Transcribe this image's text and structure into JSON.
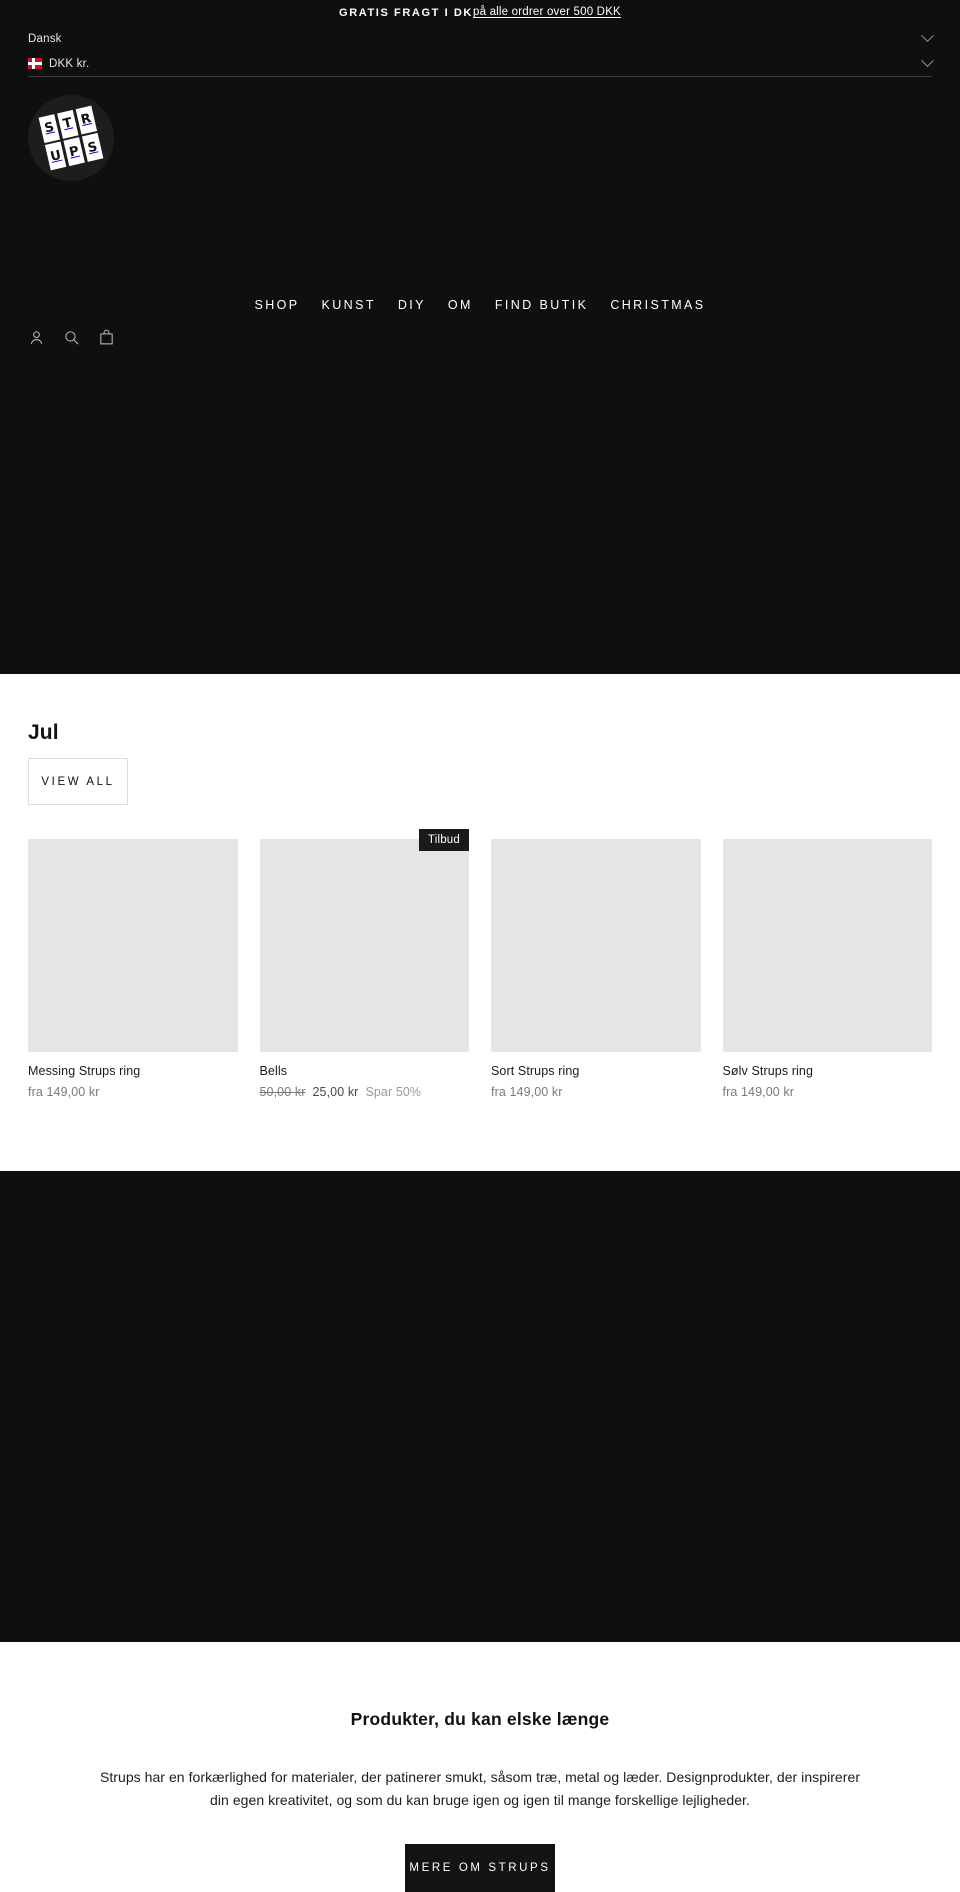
{
  "announcement": {
    "strong": "GRATIS FRAGT I DK",
    "link": "på alle ordrer over 500 DKK"
  },
  "locale": {
    "language": "Dansk",
    "currency": "DKK kr.",
    "flag": "dk-flag-icon",
    "chevron": "chevron-down-icon"
  },
  "header": {
    "logo_text": "STRUPS",
    "logo_letters": [
      "S",
      "T",
      "R",
      "U",
      "P",
      "S"
    ],
    "nav": [
      {
        "label": "SHOP"
      },
      {
        "label": "KUNST"
      },
      {
        "label": "DIY"
      },
      {
        "label": "OM"
      },
      {
        "label": "FIND BUTIK"
      },
      {
        "label": "CHRISTMAS"
      }
    ],
    "icons": [
      {
        "name": "account-icon"
      },
      {
        "name": "search-icon"
      },
      {
        "name": "cart-icon"
      }
    ]
  },
  "collection": {
    "title": "Jul",
    "view_all": "VIEW ALL",
    "products": [
      {
        "title": "Messing Strups ring",
        "price": "fra 149,00 kr",
        "badge": "",
        "old_price": "",
        "sale_price": "",
        "save": ""
      },
      {
        "title": "Bells",
        "price": "",
        "badge": "Tilbud",
        "old_price": "50,00 kr",
        "sale_price": "25,00 kr",
        "save": "Spar 50%"
      },
      {
        "title": "Sort Strups ring",
        "price": "fra 149,00 kr",
        "badge": "",
        "old_price": "",
        "sale_price": "",
        "save": ""
      },
      {
        "title": "Sølv Strups ring",
        "price": "fra 149,00 kr",
        "badge": "",
        "old_price": "",
        "sale_price": "",
        "save": ""
      }
    ]
  },
  "richtext": {
    "heading": "Produkter, du kan elske længe",
    "body": "Strups har en forkærlighed for materialer, der patinerer smukt, såsom træ, metal og læder. Designprodukter, der inspirerer din egen kreativitet, og som du kan bruge igen og igen til mange forskellige lejligheder.",
    "cta": "MERE OM STRUPS"
  },
  "colors": {
    "dark": "#0f0f0f",
    "placeholder": "#e5e5e5",
    "flag_red": "#c8102e",
    "muted_text": "#7a7a7a"
  }
}
